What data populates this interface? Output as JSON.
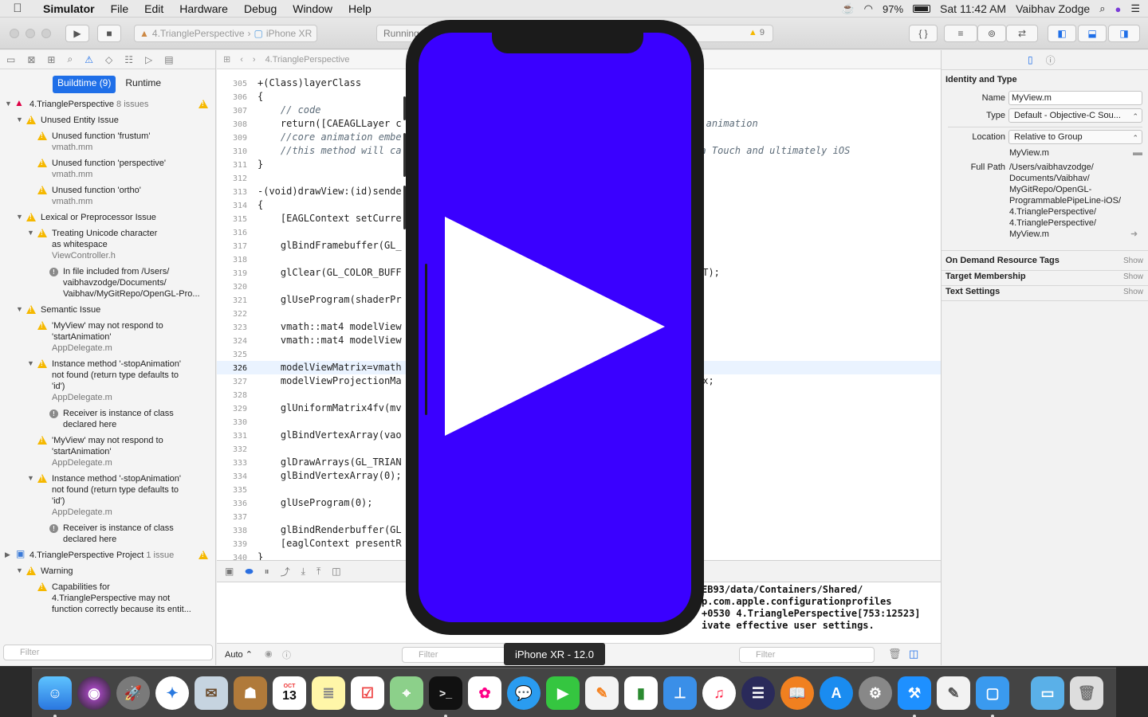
{
  "menubar": {
    "app_name": "Simulator",
    "menus": [
      "File",
      "Edit",
      "Hardware",
      "Debug",
      "Window",
      "Help"
    ],
    "battery": "97%",
    "clock": "Sat 11:42 AM",
    "user": "Vaibhav Zodge"
  },
  "toolbar": {
    "scheme_project": "4.TrianglePerspective",
    "scheme_device": "iPhone XR",
    "activity_text": "Running",
    "warning_count": "9"
  },
  "navigator": {
    "seg_buildtime": "Buildtime (9)",
    "seg_runtime": "Runtime",
    "filter_placeholder": "Filter",
    "rows": [
      {
        "text": "4.TrianglePerspective",
        "count": "8 issues"
      },
      {
        "text": "Unused Entity Issue"
      },
      {
        "text": "Unused function 'frustum'",
        "sub": "vmath.mm"
      },
      {
        "text": "Unused function 'perspective'",
        "sub": "vmath.mm"
      },
      {
        "text": "Unused function 'ortho'",
        "sub": "vmath.mm"
      },
      {
        "text": "Lexical or Preprocessor Issue"
      },
      {
        "text": "Treating Unicode character",
        "text2": "as whitespace",
        "sub": "ViewController.h"
      },
      {
        "text": "In file included from /Users/",
        "text2": "vaibhavzodge/Documents/",
        "text3": "Vaibhav/MyGitRepo/OpenGL-Pro..."
      },
      {
        "text": "Semantic Issue"
      },
      {
        "text": "'MyView' may not respond to",
        "text2": "'startAnimation'",
        "sub": "AppDelegate.m"
      },
      {
        "text": "Instance method '-stopAnimation'",
        "text2": "not found (return type defaults to",
        "text3": "'id')",
        "sub": "AppDelegate.m"
      },
      {
        "text": "Receiver is instance of class",
        "text2": "declared here"
      },
      {
        "text": "'MyView' may not respond to",
        "text2": "'startAnimation'",
        "sub": "AppDelegate.m"
      },
      {
        "text": "Instance method '-stopAnimation'",
        "text2": "not found (return type defaults to",
        "text3": "'id')",
        "sub": "AppDelegate.m"
      },
      {
        "text": "Receiver is instance of class",
        "text2": "declared here"
      },
      {
        "text": "4.TrianglePerspective Project",
        "count": "1 issue"
      },
      {
        "text": "Warning"
      },
      {
        "text": "Capabilities for",
        "text2": "4.TrianglePerspective may not",
        "text3": "function correctly because its entit..."
      }
    ]
  },
  "editor": {
    "breadcrumb": "4.TrianglePerspective",
    "lines": [
      {
        "n": "305",
        "t": "+(Class)layerClass"
      },
      {
        "n": "306",
        "t": "{"
      },
      {
        "n": "307",
        "t": "    // code"
      },
      {
        "n": "308",
        "t": "    return([CAEAGLLayer c"
      },
      {
        "n": "309",
        "t": "    //core animation embe"
      },
      {
        "n": "310",
        "t": "    //this method will ca"
      },
      {
        "n": "311",
        "t": "}"
      },
      {
        "n": "312",
        "t": ""
      },
      {
        "n": "313",
        "t": "-(void)drawView:(id)sende"
      },
      {
        "n": "314",
        "t": "{"
      },
      {
        "n": "315",
        "t": "    [EAGLContext setCurre"
      },
      {
        "n": "316",
        "t": ""
      },
      {
        "n": "317",
        "t": "    glBindFramebuffer(GL_"
      },
      {
        "n": "318",
        "t": ""
      },
      {
        "n": "319",
        "t": "    glClear(GL_COLOR_BUFF"
      },
      {
        "n": "320",
        "t": ""
      },
      {
        "n": "321",
        "t": "    glUseProgram(shaderPr"
      },
      {
        "n": "322",
        "t": ""
      },
      {
        "n": "323",
        "t": "    vmath::mat4 modelView"
      },
      {
        "n": "324",
        "t": "    vmath::mat4 modelView"
      },
      {
        "n": "325",
        "t": ""
      },
      {
        "n": "326",
        "t": "    modelViewMatrix=vmath"
      },
      {
        "n": "327",
        "t": "    modelViewProjectionMa"
      },
      {
        "n": "328",
        "t": ""
      },
      {
        "n": "329",
        "t": "    glUniformMatrix4fv(mv"
      },
      {
        "n": "330",
        "t": ""
      },
      {
        "n": "331",
        "t": "    glBindVertexArray(vao"
      },
      {
        "n": "332",
        "t": ""
      },
      {
        "n": "333",
        "t": "    glDrawArrays(GL_TRIAN"
      },
      {
        "n": "334",
        "t": "    glBindVertexArray(0);"
      },
      {
        "n": "335",
        "t": ""
      },
      {
        "n": "336",
        "t": "    glUseProgram(0);"
      },
      {
        "n": "337",
        "t": ""
      },
      {
        "n": "338",
        "t": "    glBindRenderbuffer(GL"
      },
      {
        "n": "339",
        "t": "    [eaglContext presentR"
      },
      {
        "n": "340",
        "t": "}"
      }
    ],
    "right_fragments": {
      "l308": "do animation",
      "l310": "coa Touch and ultimately iOS",
      "l319": "IT);",
      "l327": "ix;"
    }
  },
  "console": {
    "lines": [
      "EB93/data/Containers/Shared/",
      "p.com.apple.configurationprofiles",
      "+0530 4.TrianglePerspective[753:12523]",
      "ivate effective user settings."
    ],
    "scope": "Auto",
    "filter_placeholder": "Filter",
    "filter2_placeholder": "Filter"
  },
  "inspector": {
    "section_identity": "Identity and Type",
    "name_label": "Name",
    "name_value": "MyView.m",
    "type_label": "Type",
    "type_value": "Default - Objective-C Sou...",
    "location_label": "Location",
    "location_value": "Relative to Group",
    "location_file": "MyView.m",
    "fullpath_label": "Full Path",
    "fullpath_lines": [
      "/Users/vaibhavzodge/",
      "Documents/Vaibhav/",
      "MyGitRepo/OpenGL-",
      "ProgrammablePipeLine-iOS/",
      "4.TrianglePerspective/",
      "4.TrianglePerspective/",
      "MyView.m"
    ],
    "section_odr": "On Demand Resource Tags",
    "section_target": "Target Membership",
    "section_text": "Text Settings",
    "show_label": "Show"
  },
  "simulator": {
    "device_label": "iPhone XR - 12.0",
    "screen_color": "#3a00ff",
    "triangle_color": "#ffffff"
  },
  "dock": {
    "calendar_month": "OCT",
    "calendar_day": "13"
  }
}
